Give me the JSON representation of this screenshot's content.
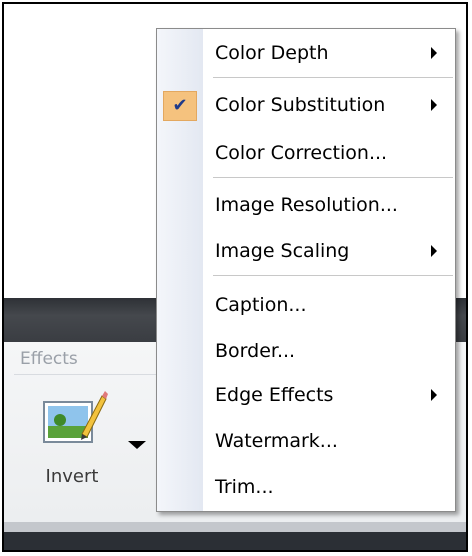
{
  "ribbon": {
    "group_label": "Effects",
    "invert_label": "Invert"
  },
  "menu": {
    "items": [
      {
        "label": "Color Depth",
        "submenu": true,
        "checked": false
      },
      {
        "label": "Color Substitution",
        "submenu": true,
        "checked": true
      },
      {
        "label": "Color Correction...",
        "submenu": false,
        "checked": false
      },
      {
        "label": "Image Resolution...",
        "submenu": false,
        "checked": false
      },
      {
        "label": "Image Scaling",
        "submenu": true,
        "checked": false
      },
      {
        "label": "Caption...",
        "submenu": false,
        "checked": false
      },
      {
        "label": "Border...",
        "submenu": false,
        "checked": false
      },
      {
        "label": "Edge Effects",
        "submenu": true,
        "checked": false
      },
      {
        "label": "Watermark...",
        "submenu": false,
        "checked": false
      },
      {
        "label": "Trim...",
        "submenu": false,
        "checked": false
      }
    ]
  },
  "colors": {
    "check_highlight": "#f5c27e",
    "dark_band": "#3a3d42"
  }
}
